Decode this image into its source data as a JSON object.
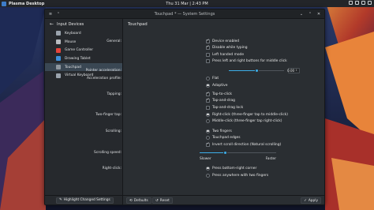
{
  "panel": {
    "app_name": "Plasma Desktop",
    "clock": "Thu 31 Mar  |  2:43 PM"
  },
  "window": {
    "title": "Touchpad * — System Settings"
  },
  "sidebar": {
    "back_label": "Input Devices",
    "items": [
      {
        "label": "Keyboard",
        "icon": "keyboard-icon",
        "color": "#9aa3ad"
      },
      {
        "label": "Mouse",
        "icon": "mouse-icon",
        "color": "#b8bcc1"
      },
      {
        "label": "Game Controller",
        "icon": "gamepad-icon",
        "color": "#e3443c"
      },
      {
        "label": "Drawing Tablet",
        "icon": "tablet-icon",
        "color": "#3d8fd9"
      },
      {
        "label": "Touchpad",
        "icon": "touchpad-icon",
        "color": "#8e969e"
      },
      {
        "label": "Virtual Keyboard",
        "icon": "virtual-keyboard-icon",
        "color": "#9aa3ad"
      }
    ],
    "active_index": 4,
    "highlight_button": "Highlight Changed Settings"
  },
  "main": {
    "heading": "Touchpad",
    "general_label": "General:",
    "device_enabled": "Device enabled",
    "disable_while_typing": "Disable while typing",
    "left_handed": "Left handed mode",
    "press_left_right": "Press left and right buttons for middle click",
    "pointer_accel_label": "Pointer acceleration:",
    "pointer_accel_value": "0.00",
    "pointer_accel_fraction": 0.5,
    "accel_profile_label": "Acceleration profile:",
    "profile_flat": "Flat",
    "profile_adaptive": "Adaptive",
    "tapping_label": "Tapping:",
    "tap_to_click": "Tap-to-click",
    "tap_and_drag": "Tap-and-drag",
    "tap_drag_lock": "Tap-and-drag lock",
    "two_finger_label": "Two-finger tap:",
    "right_click_three": "Right-click (three-finger tap to middle-click)",
    "middle_click_three": "Middle-click (three-finger tap right-click)",
    "scrolling_label": "Scrolling:",
    "two_fingers": "Two fingers",
    "touchpad_edges": "Touchpad edges",
    "invert_scroll": "Invert scroll direction (Natural scrolling)",
    "scroll_speed_label": "Scrolling speed:",
    "scroll_speed_fraction": 0.33,
    "slower": "Slower",
    "faster": "Faster",
    "right_click_label": "Right-click:",
    "press_bottom_right": "Press bottom-right corner",
    "press_two_fingers": "Press anywhere with two fingers",
    "defaults_button": "Defaults",
    "reset_button": "Reset",
    "apply_button": "Apply"
  },
  "colors": {
    "accent": "#3daee9",
    "window_bg": "#2a2e32"
  }
}
